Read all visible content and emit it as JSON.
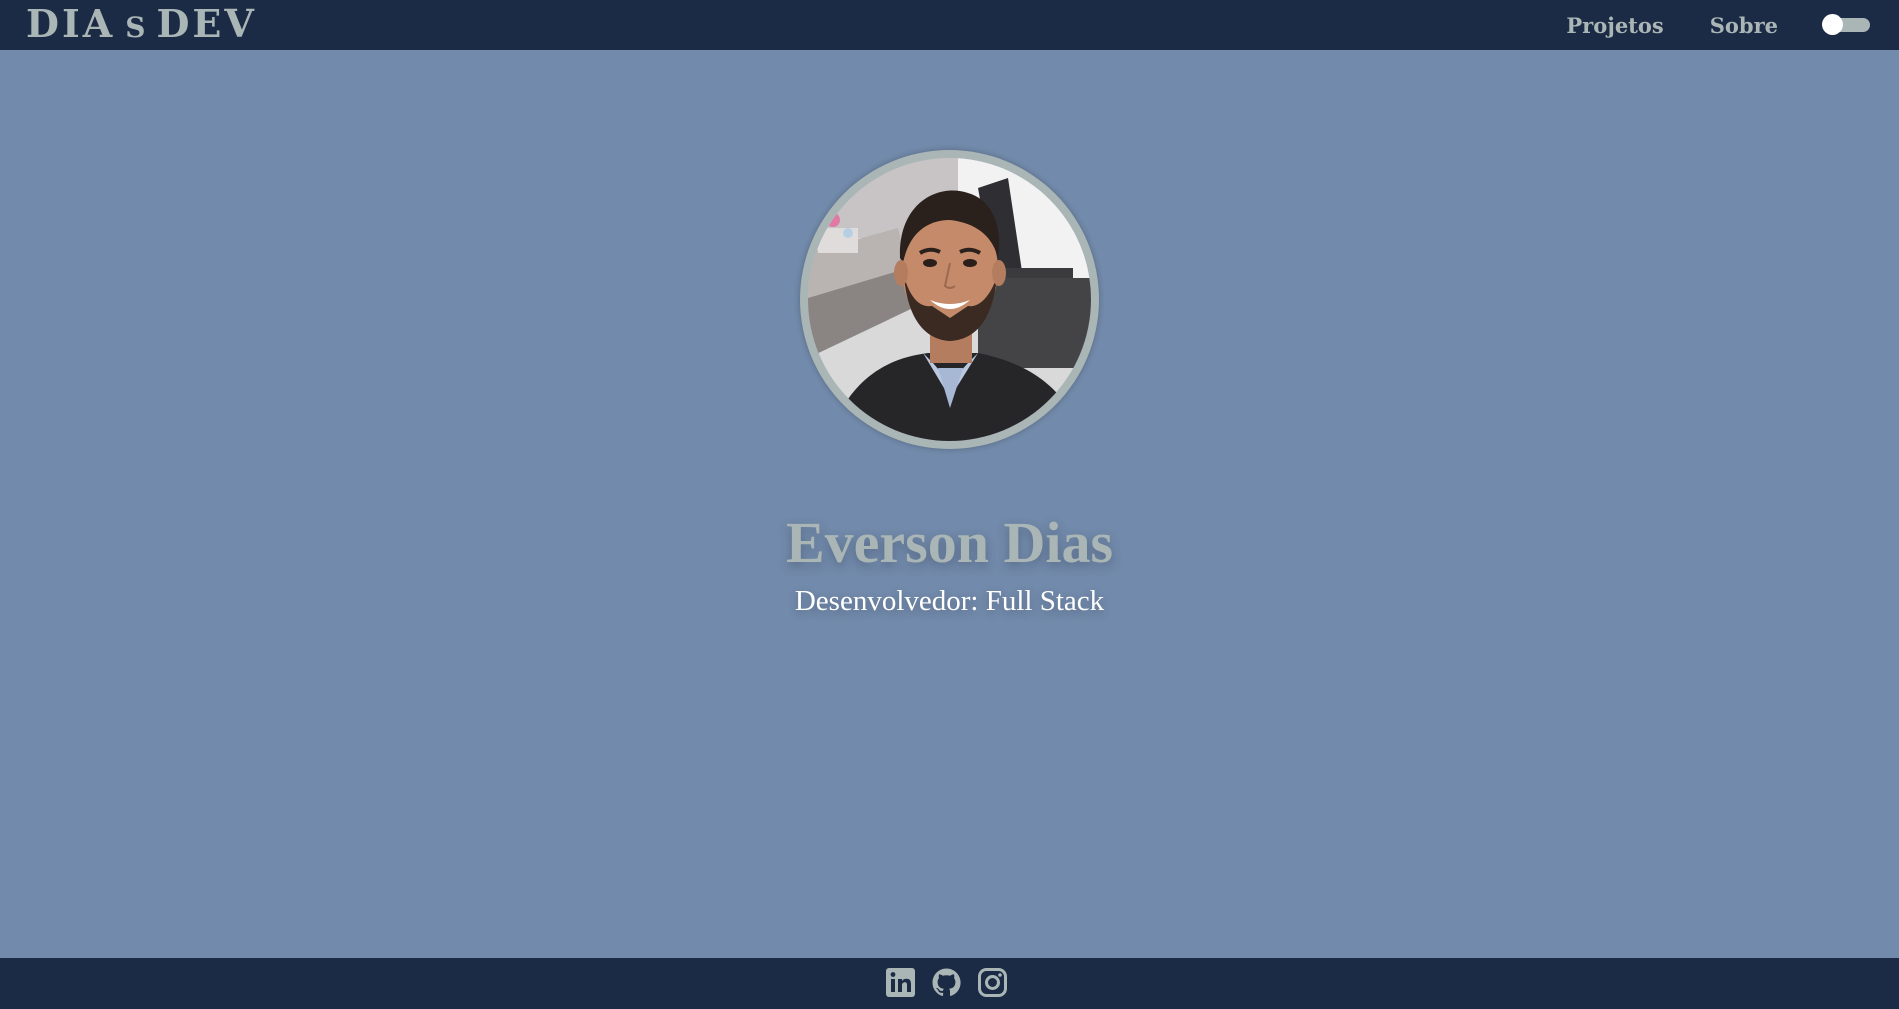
{
  "header": {
    "logo": {
      "part1": "DIA",
      "part2": "S",
      "part3": "DEV"
    },
    "nav": [
      {
        "label": "Projetos"
      },
      {
        "label": "Sobre"
      }
    ],
    "theme_toggle": {
      "state": "off"
    }
  },
  "profile": {
    "name": "Everson Dias",
    "role": "Desenvolvedor: Full Stack"
  },
  "footer": {
    "social": [
      {
        "icon": "linkedin-icon"
      },
      {
        "icon": "github-icon"
      },
      {
        "icon": "instagram-icon"
      }
    ]
  },
  "colors": {
    "header_bg": "#1c2b45",
    "page_bg": "#728aab",
    "accent": "#aab6b6",
    "text_white": "#ffffff"
  }
}
